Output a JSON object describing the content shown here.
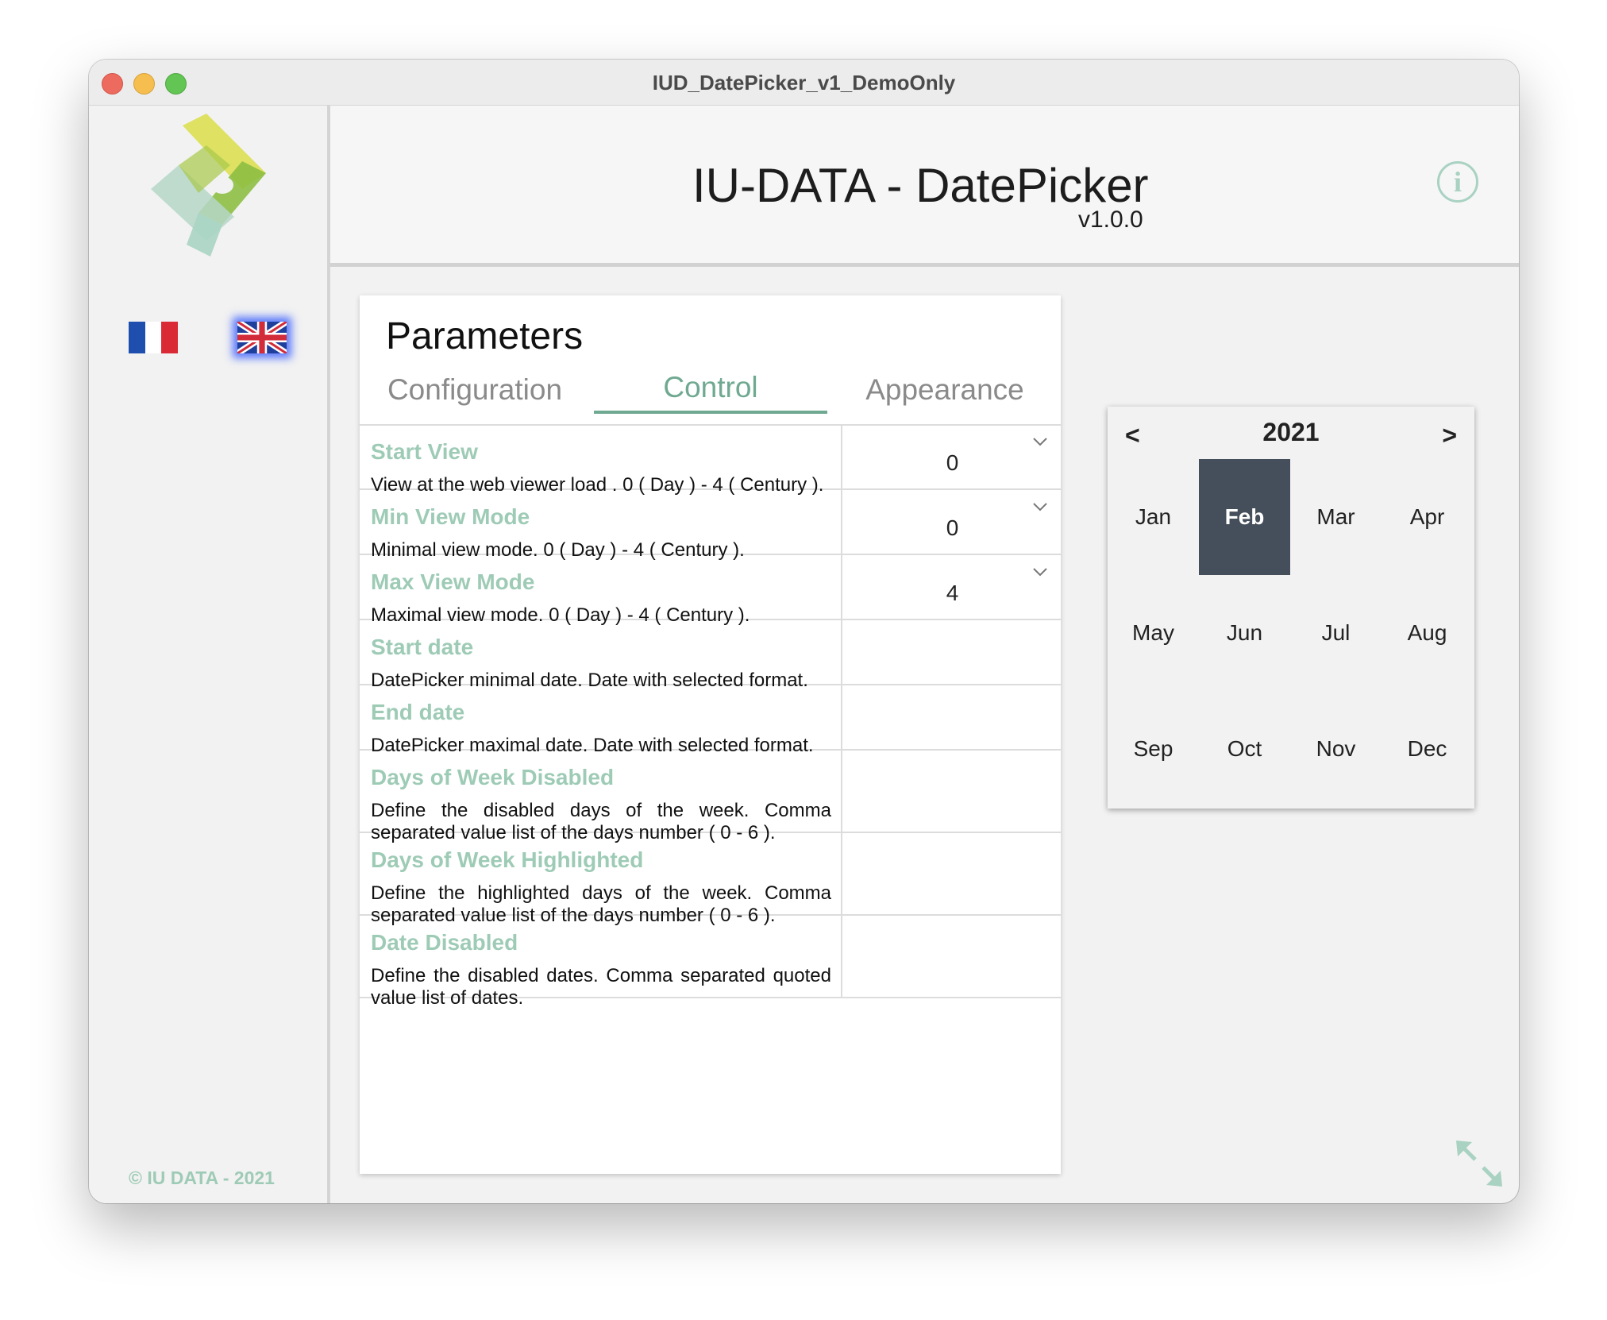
{
  "window": {
    "title": "IUD_DatePicker_v1_DemoOnly"
  },
  "header": {
    "title": "IU-DATA - DatePicker",
    "version": "v1.0.0",
    "info_glyph": "i"
  },
  "sidebar": {
    "copyright": "© IU DATA - 2021",
    "flags": [
      {
        "name": "french-flag",
        "colors": [
          "#1f4fae",
          "#ffffff",
          "#d92a35"
        ]
      },
      {
        "name": "uk-flag",
        "selected": true
      }
    ]
  },
  "params": {
    "title": "Parameters",
    "tabs": [
      {
        "label": "Configuration",
        "active": false
      },
      {
        "label": "Control",
        "active": true
      },
      {
        "label": "Appearance",
        "active": false
      }
    ],
    "rows": [
      {
        "label": "Start View",
        "desc": "View at the web viewer load . 0 ( Day ) - 4 ( Century ).",
        "value": "0",
        "dropdown": true
      },
      {
        "label": "Min View Mode",
        "desc": "Minimal view mode. 0 ( Day ) - 4 ( Century ).",
        "value": "0",
        "dropdown": true
      },
      {
        "label": "Max View Mode",
        "desc": "Maximal view mode. 0 ( Day ) - 4 ( Century ).",
        "value": "4",
        "dropdown": true
      },
      {
        "label": "Start date",
        "desc": "DatePicker minimal date. Date with selected format.",
        "value": ""
      },
      {
        "label": "End date",
        "desc": "DatePicker maximal date. Date with selected format.",
        "value": ""
      },
      {
        "label": "Days of Week Disabled",
        "desc": "Define the disabled days of the week. Comma separated value list of the days number ( 0 - 6 ).",
        "value": ""
      },
      {
        "label": "Days of Week Highlighted",
        "desc": "Define the highlighted days of the week. Comma separated value list of the days number ( 0 - 6 ).",
        "value": ""
      },
      {
        "label": "Date Disabled",
        "desc": "Define the disabled dates. Comma separated quoted value list of dates.",
        "value": ""
      }
    ]
  },
  "calendar": {
    "prev": "<",
    "next": ">",
    "year": "2021",
    "months": [
      "Jan",
      "Feb",
      "Mar",
      "Apr",
      "May",
      "Jun",
      "Jul",
      "Aug",
      "Sep",
      "Oct",
      "Nov",
      "Dec"
    ],
    "selected_month": "Feb"
  },
  "colors": {
    "accent": "#6fa991",
    "label_green": "#9ecbb6",
    "selected_month_bg": "#454f5c"
  },
  "icons": {
    "logo": "iu-data-logo",
    "info": "info-icon",
    "chevron": "chevron-down-icon",
    "resize": "expand-arrows-icon"
  }
}
